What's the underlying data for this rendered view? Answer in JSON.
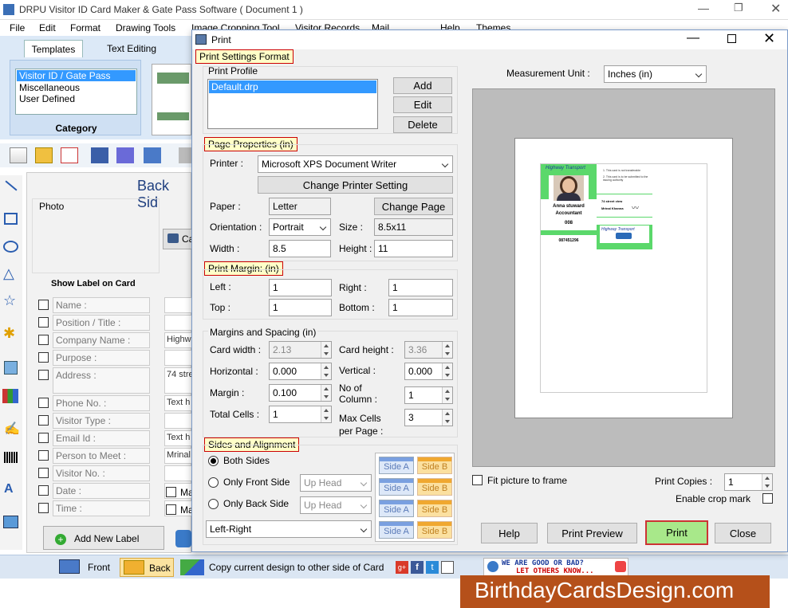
{
  "app": {
    "title": "DRPU Visitor ID Card Maker & Gate Pass Software ( Document 1 )",
    "menu": [
      "File",
      "Edit",
      "Format",
      "Drawing Tools",
      "Image Cropping Tool",
      "Visitor Records",
      "Mail",
      "Help",
      "Themes"
    ],
    "ribbon_tabs": [
      "Templates",
      "Text Editing"
    ],
    "category": {
      "items": [
        "Visitor ID / Gate Pass",
        "Miscellaneous",
        "User Defined"
      ],
      "label": "Category"
    },
    "back_side_title": "Back Sid",
    "photo_label": "Photo",
    "capture_label": "Ca",
    "show_label_title": "Show Label on Card",
    "label_rows": [
      "Name :",
      "Position / Title :",
      "Company Name :",
      "Purpose :",
      "Address :",
      "Phone No. :",
      "Visitor Type :",
      "Email Id :",
      "Person to Meet :",
      "Visitor No. :",
      "Date :",
      "Time :"
    ],
    "field_values": [
      "",
      "",
      "Highw",
      "",
      "74 stre",
      "Text h",
      "",
      "Text h",
      "Mrinal",
      "",
      "",
      ""
    ],
    "ma_labels": [
      "Ma",
      "Ma"
    ],
    "add_new_label": "Add New Label",
    "bottom": {
      "front": "Front",
      "back": "Back",
      "copy": "Copy current design to other side of Card"
    },
    "feedback": {
      "line1": "WE ARE GOOD OR BAD?",
      "line2": "LET OTHERS KNOW..."
    },
    "brand": "BirthdayCardsDesign.com"
  },
  "dialog": {
    "title": "Print",
    "print_settings_format": "Print Settings Format",
    "print_profile_label": "Print Profile",
    "profile_item": "Default.drp",
    "profile_buttons": [
      "Add",
      "Edit",
      "Delete"
    ],
    "page_properties": "Page Properties  (in)",
    "printer_label": "Printer :",
    "printer_value": "Microsoft XPS Document Writer",
    "change_printer": "Change Printer Setting",
    "paper_label": "Paper :",
    "paper_value": "Letter",
    "change_page": "Change Page",
    "orientation_label": "Orientation :",
    "orientation_value": "Portrait",
    "size_label": "Size :",
    "size_value": "8.5x11",
    "width_label": "Width :",
    "width_value": "8.5",
    "height_label": "Height :",
    "height_value": "11",
    "print_margin": "Print Margin: (in)",
    "left_label": "Left :",
    "left_value": "1",
    "right_label": "Right :",
    "right_value": "1",
    "top_label": "Top :",
    "top_value": "1",
    "bottom_label": "Bottom :",
    "bottom_value": "1",
    "margins_spacing": "Margins and Spacing  (in)",
    "card_width_label": "Card width :",
    "card_width_value": "2.13",
    "card_height_label": "Card height :",
    "card_height_value": "3.36",
    "horizontal_label": "Horizontal :",
    "horizontal_value": "0.000",
    "vertical_label": "Vertical :",
    "vertical_value": "0.000",
    "margin_label": "Margin :",
    "margin_value": "0.100",
    "no_of_column_label": "No of\nColumn :",
    "no_of_column_value": "1",
    "total_cells_label": "Total Cells :",
    "total_cells_value": "1",
    "max_cells_label": "Max Cells\nper Page :",
    "max_cells_value": "3",
    "sides_alignment": "Sides and Alignment",
    "both_sides": "Both Sides",
    "only_front": "Only Front Side",
    "only_back": "Only Back Side",
    "up_head": "Up Head",
    "alignment_value": "Left-Right",
    "side_a": "Side A",
    "side_b": "Side B",
    "measurement_label": "Measurement Unit :",
    "measurement_value": "Inches (in)",
    "fit_picture": "Fit picture to frame",
    "print_copies_label": "Print Copies :",
    "print_copies_value": "1",
    "enable_crop_mark": "Enable crop mark",
    "buttons": {
      "help": "Help",
      "preview": "Print Preview",
      "print": "Print",
      "close": "Close"
    },
    "card_preview": {
      "company": "Highway Transport",
      "name": "Anna stuward",
      "position": "Accountant",
      "id": "008",
      "phone": "087451296",
      "address": "74 street view",
      "person": "Mrinal Khanna",
      "note1": "1. This card is not transferable",
      "note2": "2. This card is to be submitted to the issuing authority"
    }
  },
  "colors": {
    "accent_green": "#5bd86b",
    "print_btn": "#a8e88a",
    "header_bg": "#ffffc8",
    "header_border": "#cc0000",
    "brand_bg": "#b5501a"
  }
}
